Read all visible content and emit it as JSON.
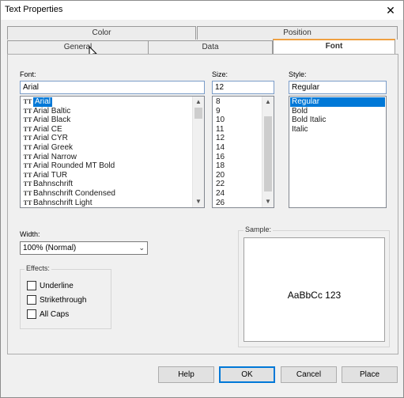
{
  "window": {
    "title": "Text Properties",
    "close_glyph": "✕"
  },
  "tabs": {
    "row1": [
      {
        "label": "Color"
      },
      {
        "label": "Position"
      }
    ],
    "row2": [
      {
        "label": "General"
      },
      {
        "label": "Data"
      },
      {
        "label": "Font",
        "active": true
      }
    ]
  },
  "font": {
    "label": "Font:",
    "value": "Arial",
    "items": [
      "Arial",
      "Arial Baltic",
      "Arial Black",
      "Arial CE",
      "Arial CYR",
      "Arial Greek",
      "Arial Narrow",
      "Arial Rounded MT Bold",
      "Arial TUR",
      "Bahnschrift",
      "Bahnschrift Condensed",
      "Bahnschrift Light"
    ],
    "selected": "Arial",
    "font_glyph": "TT"
  },
  "size": {
    "label": "Size:",
    "value": "12",
    "items": [
      "8",
      "9",
      "10",
      "11",
      "12",
      "14",
      "16",
      "18",
      "20",
      "22",
      "24",
      "26"
    ]
  },
  "style": {
    "label": "Style:",
    "value": "Regular",
    "items": [
      "Regular",
      "Bold",
      "Bold Italic",
      "Italic"
    ],
    "selected": "Regular"
  },
  "width": {
    "label": "Width:",
    "value": "100% (Normal)"
  },
  "effects": {
    "label": "Effects:",
    "options": [
      {
        "label": "Underline",
        "checked": false
      },
      {
        "label": "Strikethrough",
        "checked": false
      },
      {
        "label": "All Caps",
        "checked": false
      }
    ]
  },
  "sample": {
    "label": "Sample:",
    "text": "AaBbCc 123"
  },
  "buttons": {
    "help": "Help",
    "ok": "OK",
    "cancel": "Cancel",
    "place": "Place"
  },
  "scroll": {
    "up": "▲",
    "down": "▼"
  },
  "combo_arrow": "⌄",
  "colors": {
    "selection": "#0078d7",
    "active_tab_accent": "#f0a040"
  }
}
